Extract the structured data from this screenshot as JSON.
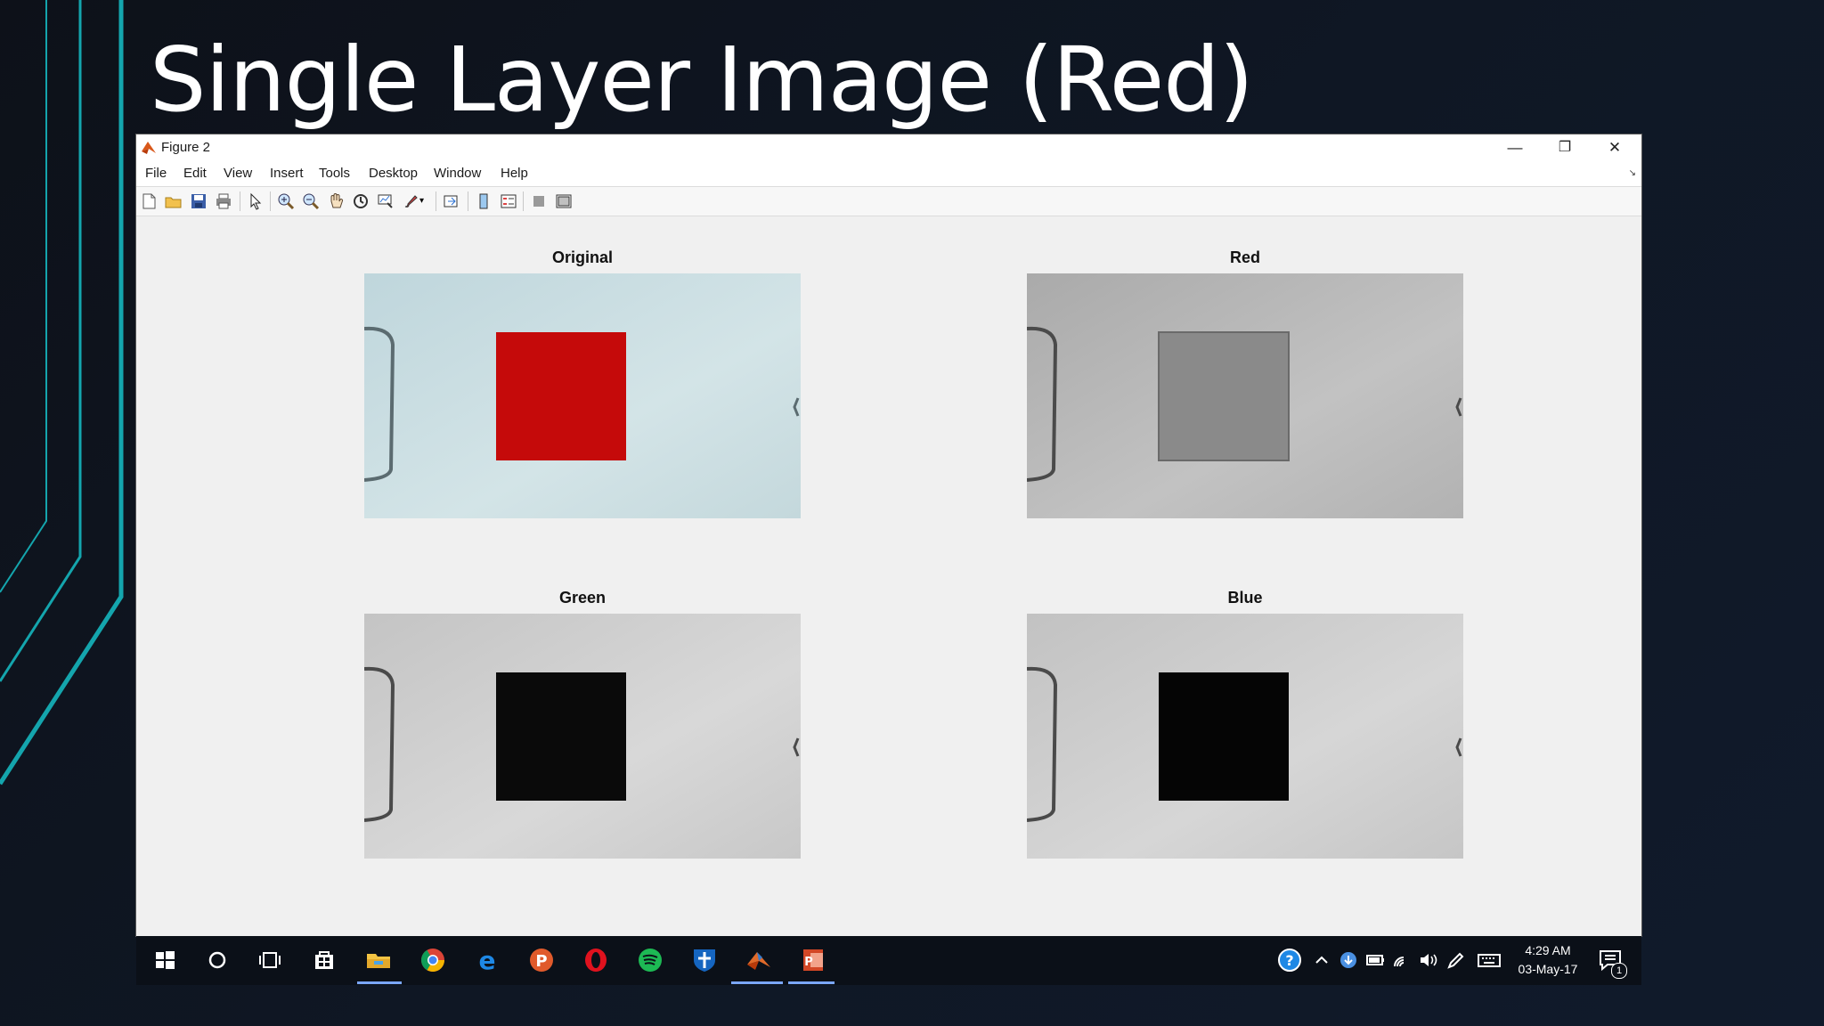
{
  "slide": {
    "title": "Single Layer Image (Red)"
  },
  "window": {
    "title": "Figure 2",
    "controls": {
      "minimize": "—",
      "restore": "❐",
      "close": "✕"
    }
  },
  "menu": [
    "File",
    "Edit",
    "View",
    "Insert",
    "Tools",
    "Desktop",
    "Window",
    "Help"
  ],
  "toolbar": {
    "icons": [
      "new-figure-icon",
      "open-file-icon",
      "save-icon",
      "print-icon",
      "select-arrow-icon",
      "zoom-in-icon",
      "zoom-out-icon",
      "pan-hand-icon",
      "rotate-3d-icon",
      "data-cursor-icon",
      "brush-icon",
      "link-plot-icon",
      "colorbar-icon",
      "legend-icon",
      "hide-plot-tools-icon",
      "show-plot-tools-icon"
    ]
  },
  "subplots": [
    {
      "title": "Original",
      "mode": "color",
      "square_color": "#c50a0a",
      "background": "#c9dde2"
    },
    {
      "title": "Red",
      "mode": "red-channel",
      "square_color": "#8a8a8a",
      "background": "#b8b8b8"
    },
    {
      "title": "Green",
      "mode": "green-channel",
      "square_color": "#0a0a0a",
      "background": "#cdcdcd"
    },
    {
      "title": "Blue",
      "mode": "blue-channel",
      "square_color": "#050505",
      "background": "#cccccc"
    }
  ],
  "taskbar": {
    "apps": [
      "windows-start-icon",
      "cortana-search-icon",
      "task-view-icon",
      "store-icon",
      "file-explorer-icon",
      "chrome-icon",
      "edge-icon",
      "app-p-icon",
      "opera-icon",
      "spotify-icon",
      "security-shield-icon",
      "matlab-icon",
      "powerpoint-icon"
    ],
    "tray": [
      "help-icon",
      "show-hidden-icons-chevron",
      "download-icon",
      "battery-icon",
      "wifi-icon",
      "volume-icon",
      "pen-icon",
      "keyboard-icon"
    ],
    "time": "4:29 AM",
    "date": "03-May-17",
    "notification_count": "1"
  }
}
